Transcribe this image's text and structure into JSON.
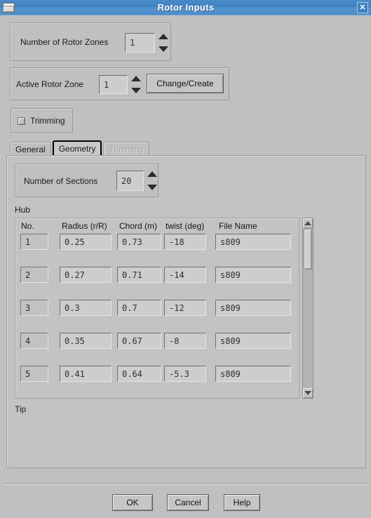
{
  "window": {
    "title": "Rotor Inputs",
    "icon": "window-restore-icon",
    "close_label": "✕",
    "bg_color": "#c0c0c0",
    "titlebar_color": "#4a8bc9"
  },
  "rotor_zones": {
    "label": "Number of Rotor Zones",
    "value": "1"
  },
  "active_zone": {
    "label": "Active Rotor Zone",
    "value": "1",
    "change_create_label": "Change/Create"
  },
  "trimming_checkbox": {
    "label": "Trimming",
    "checked": false
  },
  "tabs": [
    {
      "label": "General",
      "selected": false,
      "disabled": false
    },
    {
      "label": "Geometry",
      "selected": true,
      "disabled": false
    },
    {
      "label": "Trimming",
      "selected": false,
      "disabled": true
    }
  ],
  "sections": {
    "label": "Number of Sections",
    "value": "20"
  },
  "table": {
    "hub_label": "Hub",
    "tip_label": "Tip",
    "headers": [
      "No.",
      "Radius (r/R)",
      "Chord (m)",
      "twist (deg)",
      "File Name"
    ],
    "rows": [
      {
        "no": "1",
        "radius": "0.25",
        "chord": "0.73",
        "twist": "-18",
        "file": "s809"
      },
      {
        "no": "2",
        "radius": "0.27",
        "chord": "0.71",
        "twist": "-14",
        "file": "s809"
      },
      {
        "no": "3",
        "radius": "0.3",
        "chord": "0.7",
        "twist": "-12",
        "file": "s809"
      },
      {
        "no": "4",
        "radius": "0.35",
        "chord": "0.67",
        "twist": "-8",
        "file": "s809"
      },
      {
        "no": "5",
        "radius": "0.41",
        "chord": "0.64",
        "twist": "-5.3",
        "file": "s809"
      }
    ]
  },
  "footer": {
    "ok_label": "OK",
    "cancel_label": "Cancel",
    "help_label": "Help"
  }
}
